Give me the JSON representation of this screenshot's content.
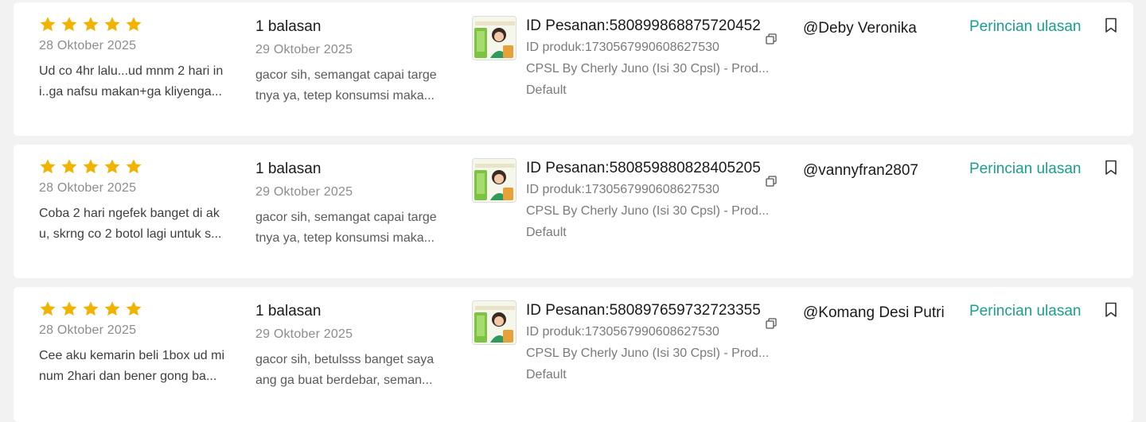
{
  "colors": {
    "star": "#f0b400",
    "accent": "#1a9e8f",
    "background": "#f2f2f2",
    "card": "#ffffff"
  },
  "reviews": [
    {
      "rating": 5,
      "review_date": "28 Oktober 2025",
      "review_text": [
        "Ud co 4hr lalu...ud mnm 2 hari in",
        "i..ga nafsu makan+ga kliyenga..."
      ],
      "reply_count": "1 balasan",
      "reply_date": "29 Oktober 2025",
      "reply_text": [
        "gacor sih, semangat capai targe",
        "tnya ya, tetep konsumsi maka..."
      ],
      "order_id": "ID Pesanan:580899868875720452",
      "product_id": "ID produk:1730567990608627530",
      "product_name": "CPSL By Cherly Juno (Isi 30 Cpsl) - Prod...",
      "variant": "Default",
      "username": "@Deby Veronika",
      "detail_label": "Perincian ulasan"
    },
    {
      "rating": 5,
      "review_date": "28 Oktober 2025",
      "review_text": [
        "Coba 2 hari ngefek banget di ak",
        "u, skrng co 2 botol lagi untuk s..."
      ],
      "reply_count": "1 balasan",
      "reply_date": "29 Oktober 2025",
      "reply_text": [
        "gacor sih, semangat capai targe",
        "tnya ya, tetep konsumsi maka..."
      ],
      "order_id": "ID Pesanan:580859880828405205",
      "product_id": "ID produk:1730567990608627530",
      "product_name": "CPSL By Cherly Juno (Isi 30 Cpsl) - Prod...",
      "variant": "Default",
      "username": "@vannyfran2807",
      "detail_label": "Perincian ulasan"
    },
    {
      "rating": 5,
      "review_date": "28 Oktober 2025",
      "review_text": [
        "Cee aku kemarin beli 1box ud mi",
        "num 2hari dan bener gong ba..."
      ],
      "reply_count": "1 balasan",
      "reply_date": "29 Oktober 2025",
      "reply_text": [
        "gacor sih, betulsss banget saya",
        "ang ga buat berdebar, seman..."
      ],
      "order_id": "ID Pesanan:580897659732723355",
      "product_id": "ID produk:1730567990608627530",
      "product_name": "CPSL By Cherly Juno (Isi 30 Cpsl) - Prod...",
      "variant": "Default",
      "username": "@Komang Desi Putri",
      "detail_label": "Perincian ulasan"
    }
  ],
  "icons": {
    "star": "star-icon",
    "copy": "copy-icon",
    "bookmark": "bookmark-icon",
    "product": "product-thumbnail"
  }
}
